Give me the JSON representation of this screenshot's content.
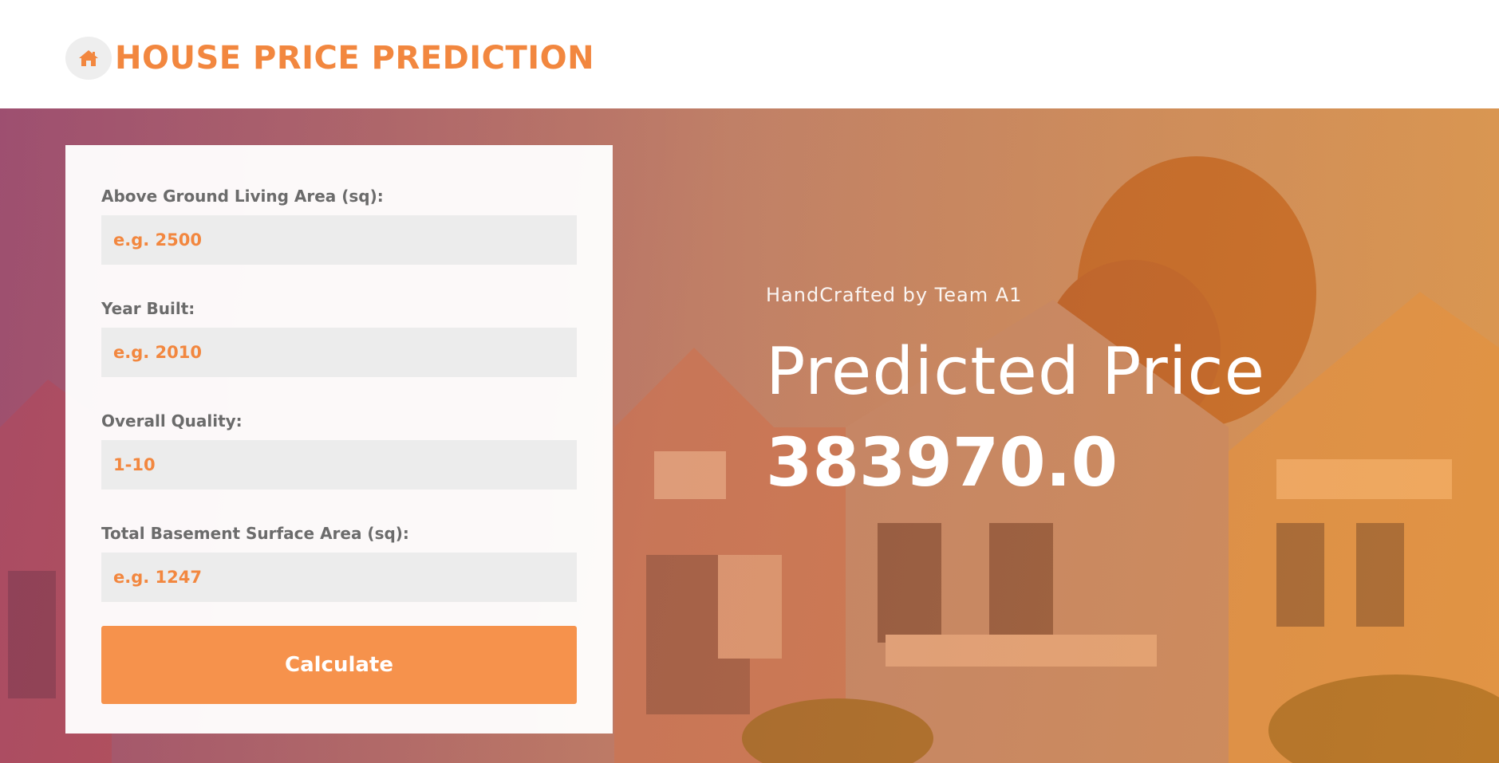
{
  "header": {
    "title": "HOUSE PRICE PREDICTION",
    "icon": "home-icon",
    "accent_color": "#f2873f"
  },
  "form": {
    "fields": [
      {
        "label": "Above Ground Living Area (sq):",
        "placeholder": "e.g. 2500",
        "value": ""
      },
      {
        "label": "Year Built:",
        "placeholder": "e.g. 2010",
        "value": ""
      },
      {
        "label": "Overall Quality:",
        "placeholder": "1-10",
        "value": ""
      },
      {
        "label": "Total Basement Surface Area (sq):",
        "placeholder": "e.g. 1247",
        "value": ""
      }
    ],
    "submit_label": "Calculate",
    "button_color": "#f6924c"
  },
  "result": {
    "tagline": "HandCrafted by Team A1",
    "title": "Predicted Price",
    "value": "383970.0"
  }
}
